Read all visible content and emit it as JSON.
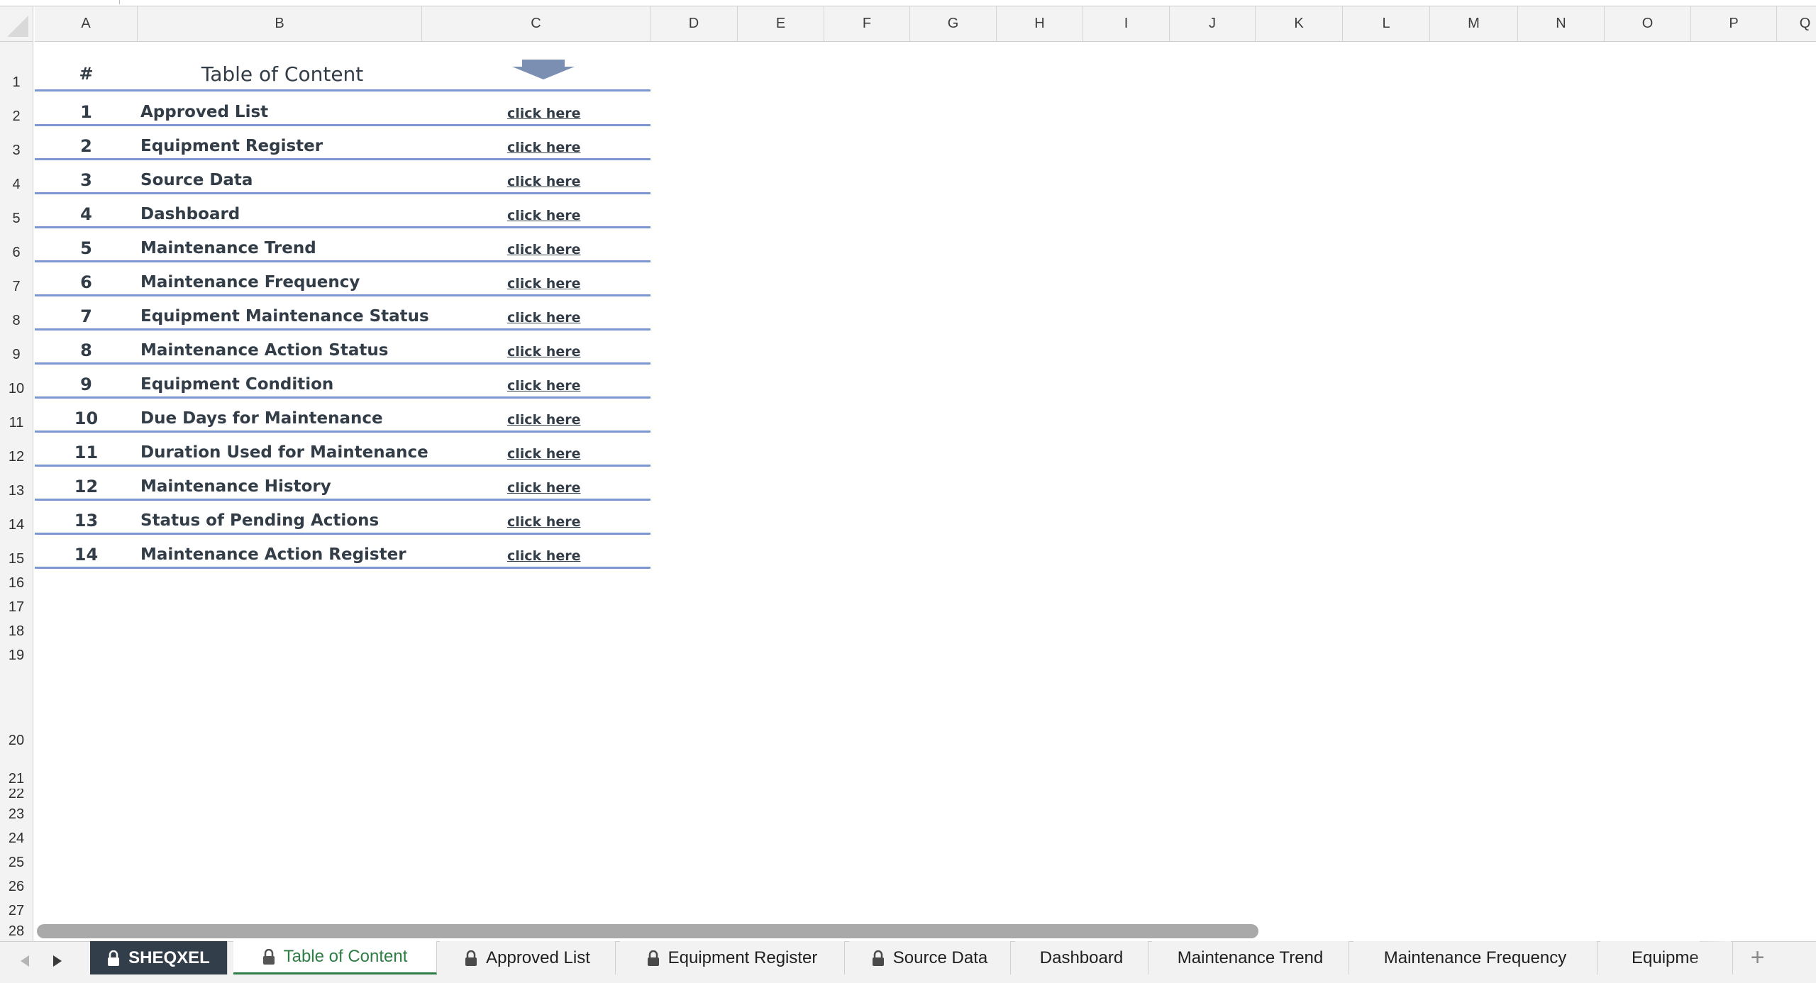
{
  "columns": [
    "A",
    "B",
    "C",
    "D",
    "E",
    "F",
    "G",
    "H",
    "I",
    "J",
    "K",
    "L",
    "M",
    "N",
    "O",
    "P",
    "Q"
  ],
  "rows": [
    "1",
    "2",
    "3",
    "4",
    "5",
    "6",
    "7",
    "8",
    "9",
    "10",
    "11",
    "12",
    "13",
    "14",
    "15",
    "16",
    "17",
    "18",
    "19",
    "20",
    "21",
    "22",
    "23",
    "24",
    "25",
    "26",
    "27",
    "28"
  ],
  "toc": {
    "num_header": "#",
    "title": "Table of Content",
    "link_label": "click here",
    "items": [
      {
        "num": "1",
        "label": "Approved List"
      },
      {
        "num": "2",
        "label": "Equipment Register"
      },
      {
        "num": "3",
        "label": "Source Data"
      },
      {
        "num": "4",
        "label": "Dashboard"
      },
      {
        "num": "5",
        "label": "Maintenance Trend"
      },
      {
        "num": "6",
        "label": "Maintenance Frequency"
      },
      {
        "num": "7",
        "label": "Equipment Maintenance Status"
      },
      {
        "num": "8",
        "label": "Maintenance Action Status"
      },
      {
        "num": "9",
        "label": "Equipment Condition"
      },
      {
        "num": "10",
        "label": "Due Days for Maintenance"
      },
      {
        "num": "11",
        "label": "Duration Used for Maintenance"
      },
      {
        "num": "12",
        "label": "Maintenance History"
      },
      {
        "num": "13",
        "label": "Status of Pending Actions"
      },
      {
        "num": "14",
        "label": "Maintenance Action Register"
      }
    ]
  },
  "tabs": [
    {
      "label": "SHEQXEL",
      "locked": true,
      "style": "dark"
    },
    {
      "label": "Table of Content",
      "locked": true,
      "style": "active"
    },
    {
      "label": "Approved List",
      "locked": true,
      "style": "normal"
    },
    {
      "label": "Equipment Register",
      "locked": true,
      "style": "normal"
    },
    {
      "label": "Source Data",
      "locked": true,
      "style": "normal"
    },
    {
      "label": "Dashboard",
      "locked": false,
      "style": "normal"
    },
    {
      "label": "Maintenance Trend",
      "locked": false,
      "style": "normal"
    },
    {
      "label": "Maintenance Frequency",
      "locked": false,
      "style": "normal"
    },
    {
      "label": "Equipmen",
      "locked": false,
      "style": "normal"
    }
  ],
  "add_tab_label": "+",
  "colors": {
    "accent_line": "#7d97d0",
    "text": "#333d47",
    "active_tab": "#2e7d45",
    "dark_tab": "#333e4b",
    "arrow": "#7b8fb3"
  },
  "icons": {
    "nav_prev": "triangle-left-icon",
    "nav_next": "triangle-right-icon",
    "lock": "lock-icon",
    "toc_arrow": "down-arrow-icon"
  }
}
